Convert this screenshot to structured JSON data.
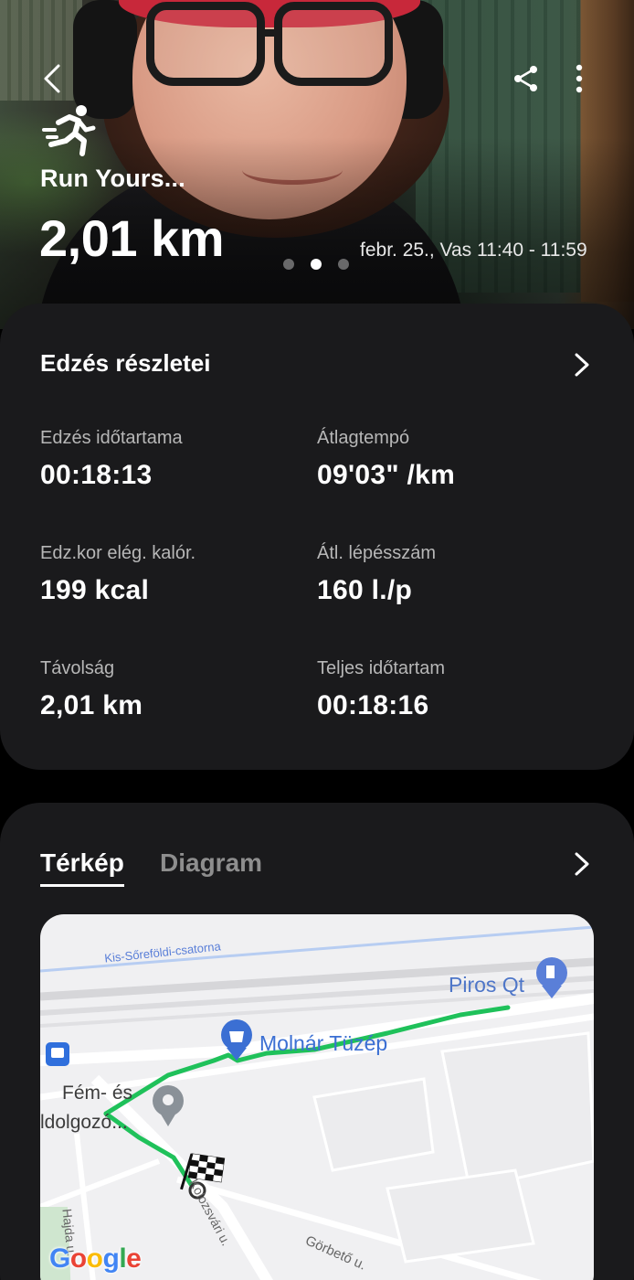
{
  "header": {
    "workout_title": "Run Yours...",
    "distance": "2,01 km",
    "date_range": "febr. 25., Vas 11:40 - 11:59",
    "page_dots": 3,
    "active_dot": 2
  },
  "icons": {
    "back": "chevron-left-icon",
    "share": "share-icon",
    "more": "more-vertical-icon",
    "activity": "running-person-icon",
    "details_chevron": "chevron-right-icon",
    "map_chevron": "chevron-right-icon"
  },
  "details": {
    "title": "Edzés részletei",
    "stats": [
      {
        "label": "Edzés időtartama",
        "value": "00:18:13"
      },
      {
        "label": "Átlagtempó",
        "value": "09'03\" /km"
      },
      {
        "label": "Edz.kor elég. kalór.",
        "value": "199 kcal"
      },
      {
        "label": "Átl. lépésszám",
        "value": "160 l./p"
      },
      {
        "label": "Távolság",
        "value": "2,01 km"
      },
      {
        "label": "Teljes időtartam",
        "value": "00:18:16"
      }
    ]
  },
  "map_section": {
    "tabs": [
      {
        "label": "Térkép",
        "active": true
      },
      {
        "label": "Diagram",
        "active": false
      }
    ],
    "map_labels": {
      "canal": "Kis-Sőreföldi-csatorna",
      "fuel_station": "Piros Qt",
      "shop": "Molnár Tüzép",
      "poi_line1": "Fém- és",
      "poi_line2": "ldolgozó...",
      "street_kolozsvari": "Kolozsvári u.",
      "street_gorbeto": "Görbető u.",
      "street_nagy": "Hajda u.",
      "map_provider": "Google"
    },
    "route_color": "#1fc15a"
  },
  "colors": {
    "background": "#000000",
    "card": "#1a1a1c",
    "label_gray": "#b7b7b7",
    "tab_inactive": "#8e8e8e"
  }
}
